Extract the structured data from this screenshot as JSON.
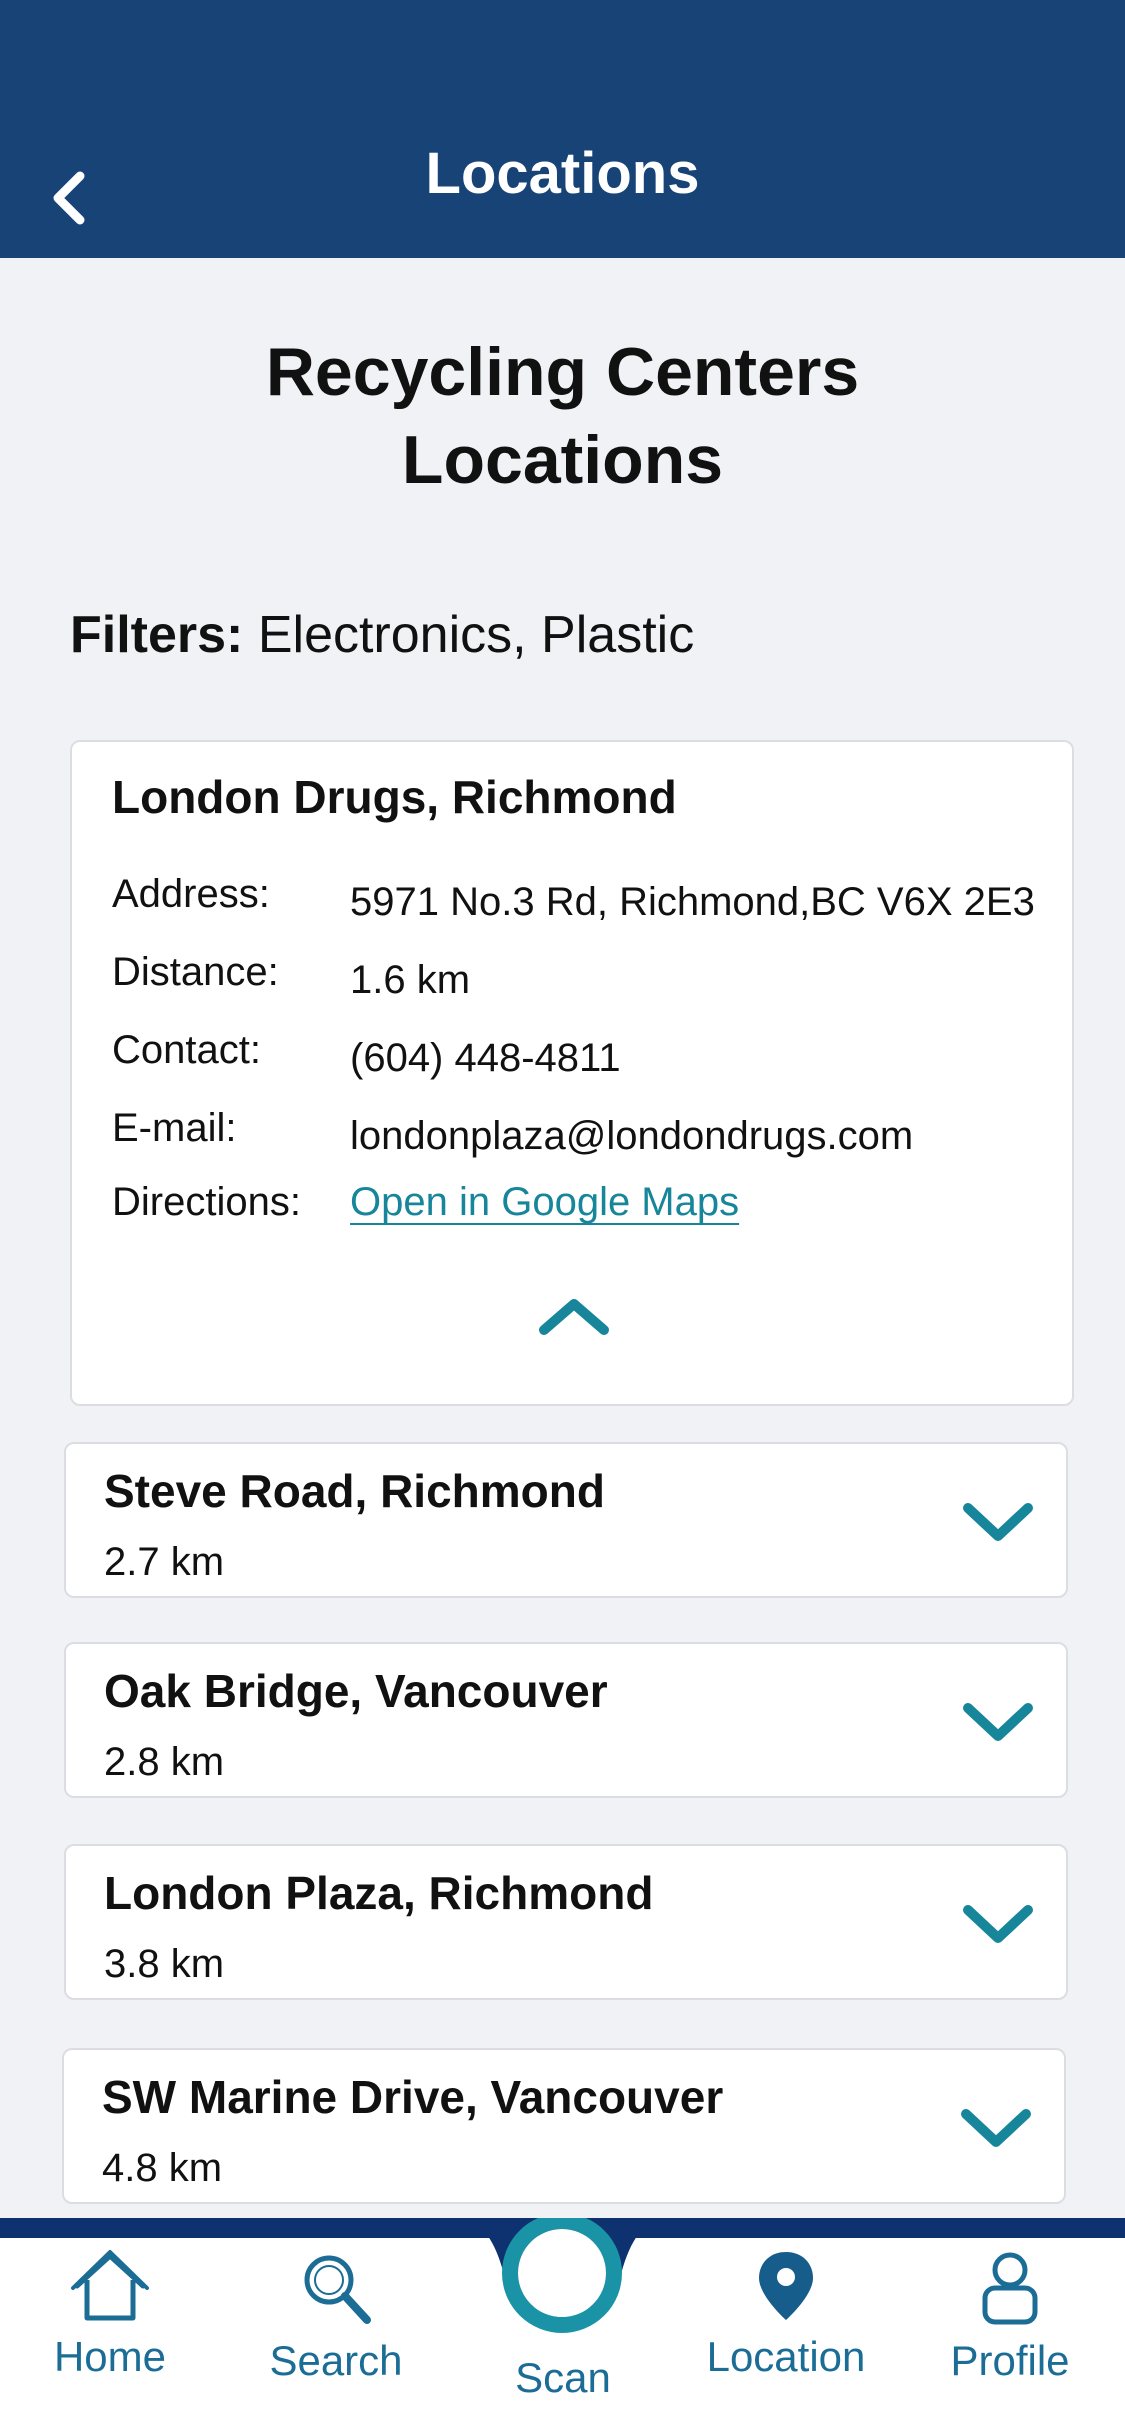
{
  "header": {
    "title": "Locations"
  },
  "page": {
    "title_line1": "Recycling Centers",
    "title_line2": "Locations",
    "filters_label": "Filters:",
    "filters_value": "Electronics, Plastic"
  },
  "expanded_location": {
    "name": "London Drugs, Richmond",
    "labels": {
      "address": "Address:",
      "distance": "Distance:",
      "contact": "Contact:",
      "email": "E-mail:",
      "directions": "Directions:"
    },
    "address": "5971 No.3 Rd, Richmond,BC V6X 2E3",
    "distance": "1.6 km",
    "contact": "(604) 448-4811",
    "email": "londonplaza@londondrugs.com",
    "directions_link": "Open in Google Maps"
  },
  "locations": [
    {
      "name": "Steve Road, Richmond",
      "distance": "2.7 km"
    },
    {
      "name": "Oak Bridge, Vancouver",
      "distance": "2.8 km"
    },
    {
      "name": "London Plaza, Richmond",
      "distance": "3.8 km"
    },
    {
      "name": "SW Marine Drive, Vancouver",
      "distance": "4.8 km"
    }
  ],
  "nav": {
    "home": "Home",
    "search": "Search",
    "scan": "Scan",
    "location": "Location",
    "profile": "Profile",
    "active": "location"
  },
  "colors": {
    "header_bg": "#174377",
    "accent": "#17869a",
    "nav_dark": "#0e3270"
  }
}
